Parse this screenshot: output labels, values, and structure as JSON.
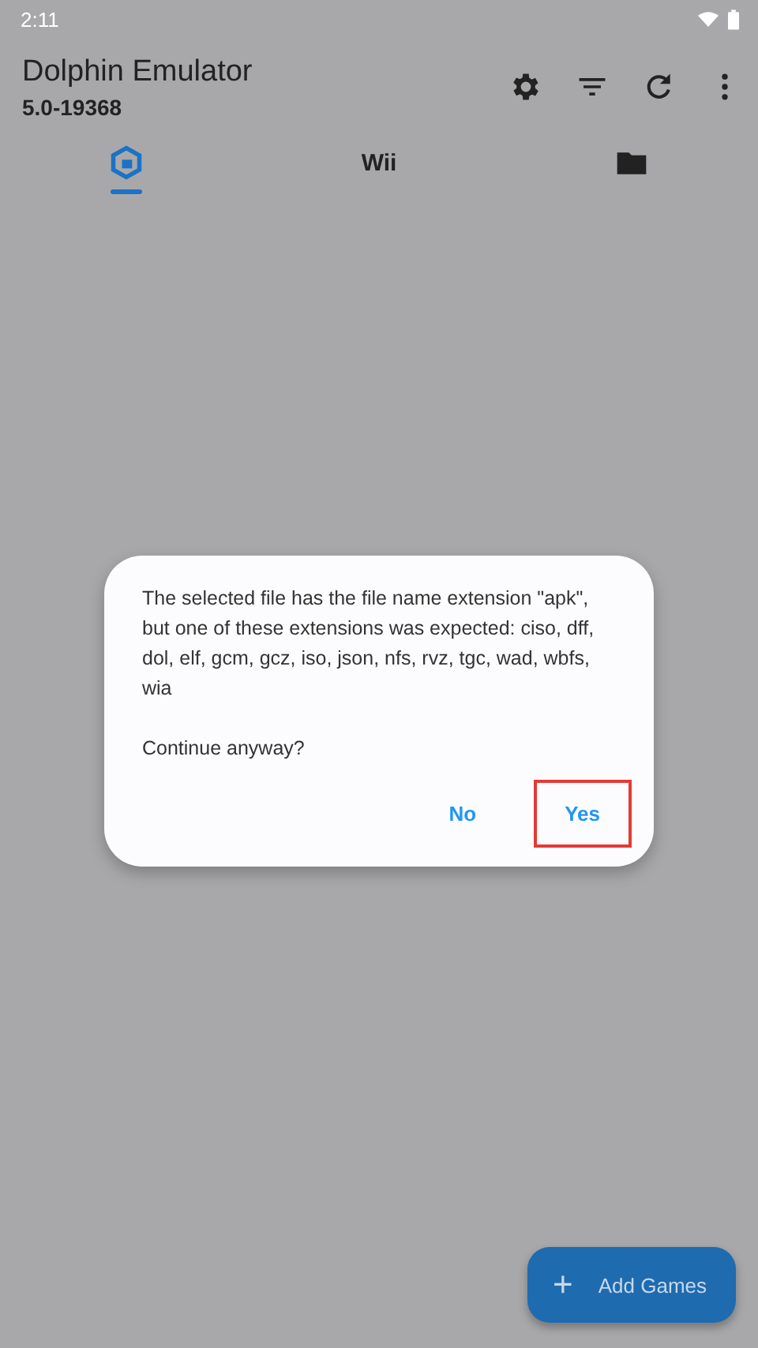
{
  "status_bar": {
    "time": "2:11"
  },
  "toolbar": {
    "title": "Dolphin Emulator",
    "subtitle": "5.0-19368",
    "actions": [
      {
        "kind": "settings"
      },
      {
        "kind": "filter"
      },
      {
        "kind": "refresh"
      },
      {
        "kind": "more"
      }
    ]
  },
  "tabs": [
    {
      "kind": "gamecube",
      "selected": true
    },
    {
      "kind": "text",
      "label": "Wii",
      "selected": false
    },
    {
      "kind": "folder",
      "selected": false
    }
  ],
  "dialog": {
    "message": "The selected file has the file name extension \"apk\", but one of these extensions was expected: ciso, dff, dol, elf, gcm, gcz, iso, json, nfs, rvz, tgc, wad, wbfs, wia",
    "question": "Continue anyway?",
    "buttons": [
      {
        "label": "No",
        "highlighted": false
      },
      {
        "label": "Yes",
        "highlighted": true
      }
    ]
  },
  "fab": {
    "icon": "+",
    "label": "Add Games"
  }
}
